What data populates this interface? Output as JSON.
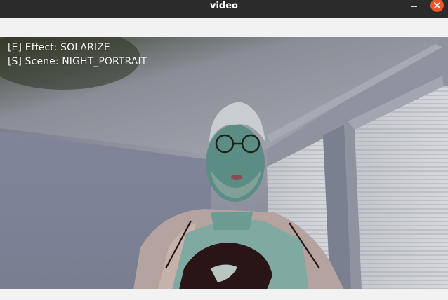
{
  "window": {
    "title": "video"
  },
  "overlay": {
    "effect_line": "[E] Effect: SOLARIZE",
    "scene_line": "[S] Scene: NIGHT_PORTRAIT"
  },
  "icons": {
    "minimize": "minimize-icon",
    "close": "close-icon"
  },
  "colors": {
    "titlebar": "#2b2b2b",
    "close_button": "#e9572b",
    "background": "#f2f2f2"
  }
}
